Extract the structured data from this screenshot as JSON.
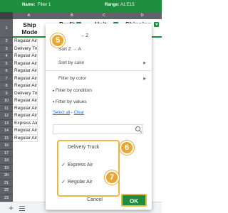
{
  "topbar": {
    "name_label": "Name:",
    "name_value": "Filter 1",
    "range_label": "Range:",
    "range_value": "A1:E15",
    "color": "#1e8e3e"
  },
  "columns": [
    "A",
    "B",
    "C",
    "D"
  ],
  "headers": {
    "ship_mode_line1": "Ship",
    "ship_mode_line2": "Mode",
    "profit": "Profit",
    "unit": "Unit",
    "shipping": "Shipping"
  },
  "row_numbers": [
    "1",
    "2",
    "3",
    "4",
    "5",
    "6",
    "7",
    "8",
    "9",
    "10",
    "11",
    "12",
    "13",
    "14",
    "15",
    "16",
    "17",
    "18",
    "19",
    "20",
    "21",
    "22",
    "23"
  ],
  "ship_mode_values": [
    "Regular Air",
    "Delivery Truck",
    "Regular Air",
    "Regular Air",
    "Regular Air",
    "Regular Air",
    "Regular Air",
    "Delivery Truck",
    "Regular Air",
    "Regular Air",
    "Regular Air",
    "Express Air",
    "Regular Air",
    "Regular Air"
  ],
  "menu": {
    "sort_az": "Sort A → Z",
    "sort_az_visible": "→ Z",
    "sort_za_visible": "Sort Z → A",
    "sort_by_color": "Sort by color",
    "filter_by_color": "Filter by color",
    "filter_by_condition": "Filter by condition",
    "filter_by_values": "Filter by values",
    "select_all": "Select all",
    "separator": " - ",
    "clear": "Clear"
  },
  "values": [
    {
      "label": "Delivery Truck",
      "checked": false
    },
    {
      "label": "Express Air",
      "checked": true
    },
    {
      "label": "Regular Air",
      "checked": true
    }
  ],
  "buttons": {
    "cancel": "Cancel",
    "ok": "OK"
  },
  "badges": {
    "b5": "5",
    "b6": "6",
    "b7": "7"
  },
  "accent_color": "#e8a735"
}
